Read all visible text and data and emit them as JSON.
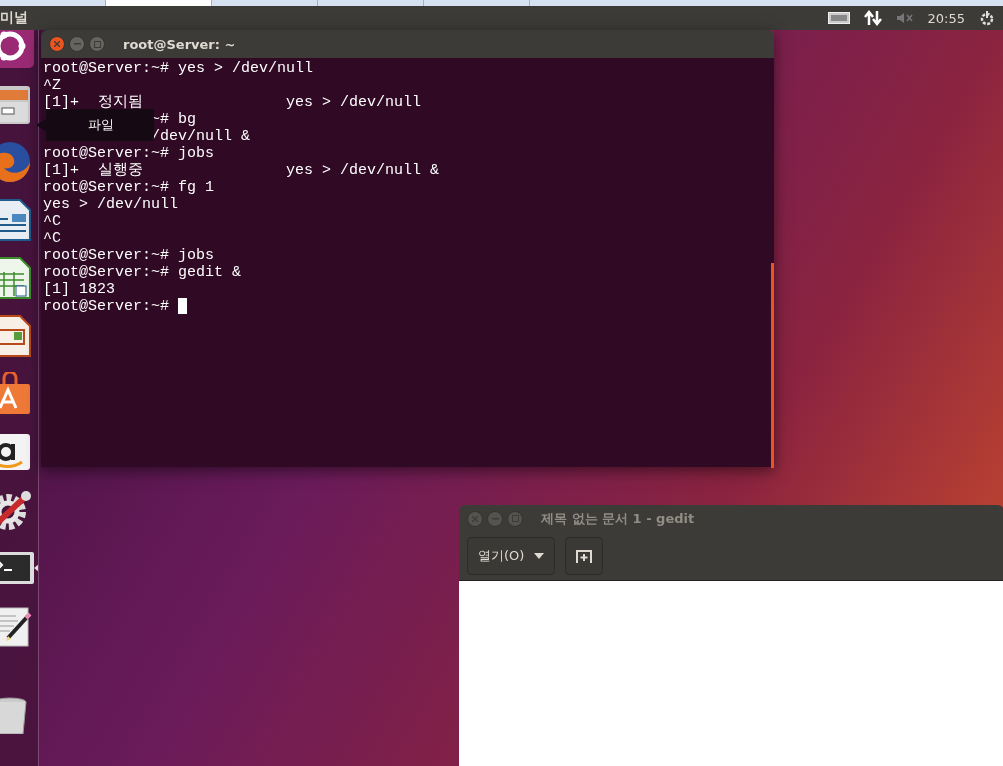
{
  "panel": {
    "app_title": "미널",
    "clock": "20:55"
  },
  "launcher": {
    "items": [
      {
        "kind": "ubuntu",
        "focused": false
      },
      {
        "kind": "files",
        "focused": false
      },
      {
        "kind": "firefox",
        "focused": false
      },
      {
        "kind": "writer",
        "focused": false
      },
      {
        "kind": "calc",
        "focused": false
      },
      {
        "kind": "impress",
        "focused": false
      },
      {
        "kind": "store",
        "focused": false
      },
      {
        "kind": "amazon",
        "focused": false
      },
      {
        "kind": "settings",
        "focused": false
      },
      {
        "kind": "terminal",
        "focused": true
      },
      {
        "kind": "editor",
        "focused": false
      },
      {
        "kind": "trash",
        "focused": false
      }
    ],
    "tooltip": "파일"
  },
  "terminal": {
    "title": "root@Server: ~",
    "lines": [
      {
        "kind": "text",
        "text": "root@Server:~# yes > /dev/null"
      },
      {
        "kind": "text",
        "text": "^Z"
      },
      {
        "kind": "job",
        "job": "[1]+",
        "status": "정지됨",
        "command": "yes > /dev/null"
      },
      {
        "kind": "covered",
        "text": "~# bg"
      },
      {
        "kind": "covered",
        "text": "/dev/null &"
      },
      {
        "kind": "text",
        "text": "root@Server:~# jobs"
      },
      {
        "kind": "job",
        "job": "[1]+",
        "status": "실행중",
        "command": "yes > /dev/null &"
      },
      {
        "kind": "text",
        "text": "root@Server:~# fg 1"
      },
      {
        "kind": "text",
        "text": "yes > /dev/null"
      },
      {
        "kind": "text",
        "text": "^C"
      },
      {
        "kind": "text",
        "text": "^C"
      },
      {
        "kind": "text",
        "text": "root@Server:~# jobs"
      },
      {
        "kind": "text",
        "text": "root@Server:~# gedit &"
      },
      {
        "kind": "text",
        "text": "[1] 1823"
      },
      {
        "kind": "prompt",
        "text": "root@Server:~# "
      }
    ]
  },
  "gedit": {
    "title": "제목 없는 문서 1 - gedit",
    "open_button": "열기(O)"
  }
}
